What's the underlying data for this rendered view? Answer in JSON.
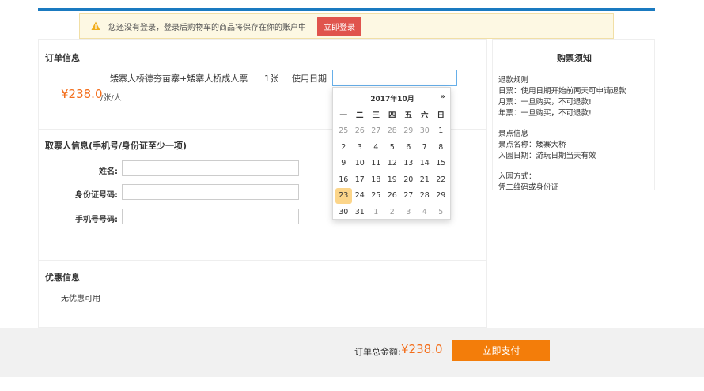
{
  "notice": {
    "message": "您还没有登录，登录后购物车的商品将保存在你的账户中",
    "login_button": "立即登录"
  },
  "order": {
    "section_title": "订单信息",
    "product_name": "矮寨大桥德夯苗寨+矮寨大桥成人票",
    "quantity": "1张",
    "date_label": "使用日期",
    "date_value": "",
    "price": "¥238.0",
    "price_unit": "/张/人"
  },
  "calendar": {
    "title": "2017年10月",
    "next": "»",
    "weekdays": [
      "一",
      "二",
      "三",
      "四",
      "五",
      "六",
      "日"
    ],
    "weeks": [
      [
        "25",
        "26",
        "27",
        "28",
        "29",
        "30",
        "1"
      ],
      [
        "2",
        "3",
        "4",
        "5",
        "6",
        "7",
        "8"
      ],
      [
        "9",
        "10",
        "11",
        "12",
        "13",
        "14",
        "15"
      ],
      [
        "16",
        "17",
        "18",
        "19",
        "20",
        "21",
        "22"
      ],
      [
        "23",
        "24",
        "25",
        "26",
        "27",
        "28",
        "29"
      ],
      [
        "30",
        "31",
        "1",
        "2",
        "3",
        "4",
        "5"
      ]
    ],
    "selected": "23"
  },
  "ticket_holder": {
    "section_title": "取票人信息(手机号/身份证至少一项)",
    "name_label": "姓名:",
    "id_label": "身份证号码:",
    "phone_label": "手机号号码:"
  },
  "discount": {
    "section_title": "优惠信息",
    "text": "无优惠可用"
  },
  "side": {
    "title": "购票须知",
    "lines": [
      "退款规则",
      "日票：使用日期开始前两天可申请退款",
      "月票：一旦购买，不可退款!",
      "年票：一旦购买，不可退款!",
      "",
      "景点信息",
      "景点名称：矮寨大桥",
      "入园日期：游玩日期当天有效",
      "",
      "入园方式：",
      "凭二维码或身份证"
    ]
  },
  "footer": {
    "total_label": "订单总金额:",
    "total_value": "¥238.0",
    "pay_button": "立即支付"
  },
  "colors": {
    "accent_blue": "#1a7ac0",
    "price_orange": "#f36d1a",
    "pay_button": "#f37d0a",
    "login_button": "#e0544d",
    "selected_day": "#fcd589"
  }
}
